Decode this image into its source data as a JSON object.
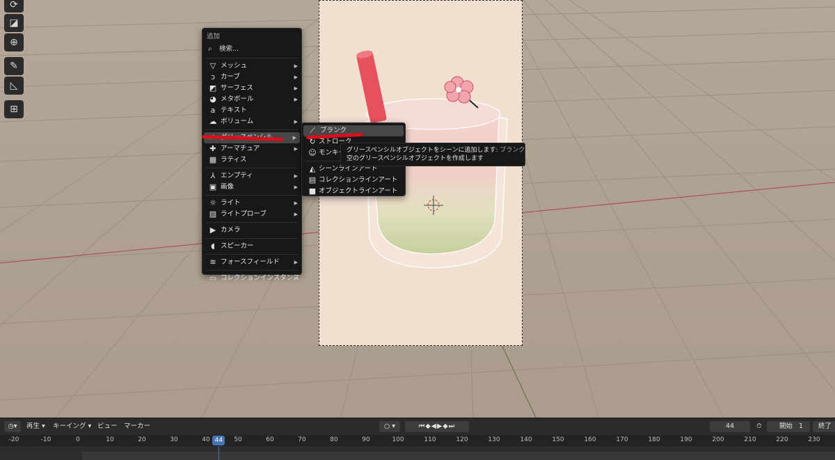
{
  "add_menu": {
    "title": "追加",
    "search_label": "検索...",
    "items": [
      {
        "label": "メッシュ",
        "icon": "mesh-icon",
        "has_submenu": true
      },
      {
        "label": "カーブ",
        "icon": "curve-icon",
        "has_submenu": true
      },
      {
        "label": "サーフェス",
        "icon": "surface-icon",
        "has_submenu": true
      },
      {
        "label": "メタボール",
        "icon": "metaball-icon",
        "has_submenu": true
      },
      {
        "label": "テキスト",
        "icon": "text-icon",
        "has_submenu": false
      },
      {
        "label": "ボリューム",
        "icon": "volume-icon",
        "has_submenu": true
      },
      {
        "label": "グリースペンシル",
        "icon": "grease-pencil-icon",
        "has_submenu": true
      },
      {
        "label": "アーマチュア",
        "icon": "armature-icon",
        "has_submenu": true
      },
      {
        "label": "ラティス",
        "icon": "lattice-icon",
        "has_submenu": false
      },
      {
        "label": "エンプティ",
        "icon": "empty-icon",
        "has_submenu": true
      },
      {
        "label": "画像",
        "icon": "image-icon",
        "has_submenu": true
      },
      {
        "label": "ライト",
        "icon": "light-icon",
        "has_submenu": true
      },
      {
        "label": "ライトプローブ",
        "icon": "light-probe-icon",
        "has_submenu": true
      },
      {
        "label": "カメラ",
        "icon": "camera-icon",
        "has_submenu": false
      },
      {
        "label": "スピーカー",
        "icon": "speaker-icon",
        "has_submenu": false
      },
      {
        "label": "フォースフィールド",
        "icon": "force-field-icon",
        "has_submenu": true
      },
      {
        "label": "コレクションインスタンス",
        "icon": "collection-instance-icon",
        "has_submenu": true
      }
    ]
  },
  "grease_pencil_submenu": {
    "items": [
      {
        "label": "ブランク",
        "icon": "blank-stroke-icon"
      },
      {
        "label": "ストローク",
        "icon": "stroke-icon"
      },
      {
        "label": "モンキー",
        "icon": "monkey-icon"
      },
      {
        "label": "シーンラインアート",
        "icon": "scene-lineart-icon"
      },
      {
        "label": "コレクションラインアート",
        "icon": "collection-lineart-icon"
      },
      {
        "label": "オブジェクトラインアート",
        "icon": "object-lineart-icon"
      }
    ]
  },
  "tooltip": {
    "line1_main": "グリースペンシルオブジェクトをシーンに追加します:",
    "line1_dim": " ブランク",
    "line2": "空のグリースペンシルオブジェクトを作成します"
  },
  "timeline": {
    "menus": [
      "再生",
      "キーイング",
      "ビュー",
      "マーカー"
    ],
    "current_frame": "44",
    "start_label": "開始",
    "start_value": "1",
    "end_label": "終了",
    "ticks": [
      "-20",
      "-10",
      "0",
      "10",
      "20",
      "30",
      "40",
      "50",
      "60",
      "70",
      "80",
      "90",
      "100",
      "110",
      "120",
      "130",
      "140",
      "150",
      "160",
      "170",
      "180",
      "190",
      "200",
      "210",
      "220",
      "230"
    ],
    "playhead_label": "44"
  },
  "colors": {
    "menu_bg": "#181818",
    "highlight": "#474747",
    "accent_blue": "#4772b3",
    "annotation_red": "#d80f1d",
    "viewport_floor": "#b3a596",
    "camera_bg": "#f1dfd0"
  }
}
